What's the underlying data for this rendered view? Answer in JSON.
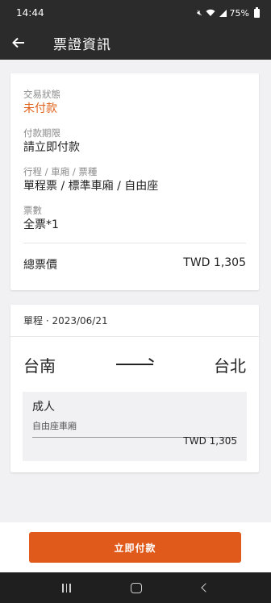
{
  "status_bar": {
    "time": "14:44",
    "battery": "75%"
  },
  "app_bar": {
    "title": "票證資訊"
  },
  "ticket_info": {
    "status_label": "交易狀態",
    "status_value": "未付款",
    "deadline_label": "付款期限",
    "deadline_value": "請立即付款",
    "trip_label": "行程 / 車廂 / 票種",
    "trip_value": "單程票 / 標準車廂 / 自由座",
    "count_label": "票數",
    "count_value": "全票*1",
    "total_label": "總票價",
    "total_value": "TWD 1,305"
  },
  "trip": {
    "header": "單程 · 2023/06/21",
    "origin": "台南",
    "destination": "台北",
    "passenger_type": "成人",
    "car_type": "自由座車廂",
    "price": "TWD 1,305"
  },
  "pay_button_label": "立即付款",
  "colors": {
    "accent": "#e05a1b",
    "bar": "#2b2b2b"
  }
}
